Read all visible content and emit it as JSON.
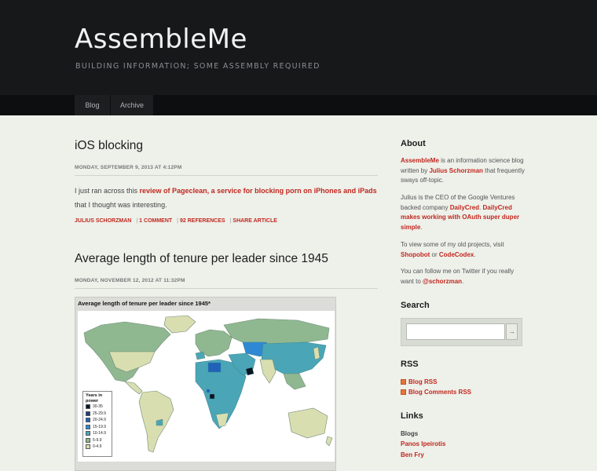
{
  "site": {
    "title": "AssembleMe",
    "tagline": "BUILDING INFORMATION; SOME ASSEMBLY REQUIRED"
  },
  "nav": {
    "items": [
      {
        "label": "Blog"
      },
      {
        "label": "Archive"
      }
    ]
  },
  "posts": [
    {
      "title": "iOS blocking",
      "date": "MONDAY, SEPTEMBER 9, 2013 AT 4:12PM",
      "body_prefix": "I just ran across this ",
      "body_link": "review of Pageclean, a service for blocking porn on iPhones and iPads",
      "body_suffix": " that I thought was interesting.",
      "meta": {
        "author": "JULIUS SCHORZMAN",
        "comments": "1 COMMENT",
        "references": "92 REFERENCES",
        "share": "SHARE ARTICLE"
      }
    },
    {
      "title": "Average length of tenure per leader since 1945",
      "date": "MONDAY, NOVEMBER 12, 2012 AT 11:32PM",
      "figure": {
        "title": "Average length of tenure per leader since 1945*",
        "legend_title": "Years in power",
        "legend": [
          {
            "label": "30-35",
            "color": "#0b1521"
          },
          {
            "label": "25-29.9",
            "color": "#1b3f7a"
          },
          {
            "label": "20-24.9",
            "color": "#1f62b8"
          },
          {
            "label": "15-19.9",
            "color": "#2f88d4"
          },
          {
            "label": "10-14.9",
            "color": "#4aa6b6"
          },
          {
            "label": "5-9.9",
            "color": "#8fb891"
          },
          {
            "label": "0-4.9",
            "color": "#d9deb0"
          }
        ]
      }
    }
  ],
  "sidebar": {
    "about": {
      "heading": "About",
      "p1_link1": "AssembleMe",
      "p1_text1": " is an information science blog written by ",
      "p1_link2": "Julius Schorzman",
      "p1_text2": " that frequently sways off-topic.",
      "p2_text1": "Julius is the CEO of the Google Ventures backed company ",
      "p2_link1": "DailyCred",
      "p2_text2": ". ",
      "p2_link2": "DailyCred makes working with OAuth super duper simple",
      "p2_text3": ".",
      "p3_text1": "To view some of my old projects, visit ",
      "p3_link1": "Shopobot",
      "p3_text2": " or ",
      "p3_link2": "CodeCodex",
      "p3_text3": ".",
      "p4_text1": "You can follow me on Twitter if you really want to ",
      "p4_link1": "@schorzman",
      "p4_text2": "."
    },
    "search": {
      "heading": "Search",
      "button": "→",
      "placeholder": ""
    },
    "rss": {
      "heading": "RSS",
      "items": [
        {
          "label": "Blog RSS"
        },
        {
          "label": "Blog Comments RSS"
        }
      ]
    },
    "links": {
      "heading": "Links",
      "subheading": "Blogs",
      "items": [
        {
          "label": "Panos Ipeirotis"
        },
        {
          "label": "Ben Fry"
        }
      ]
    }
  },
  "colors": {
    "accent": "#c0281e",
    "header_bg": "#17181a",
    "page_bg": "#eef0ea"
  }
}
